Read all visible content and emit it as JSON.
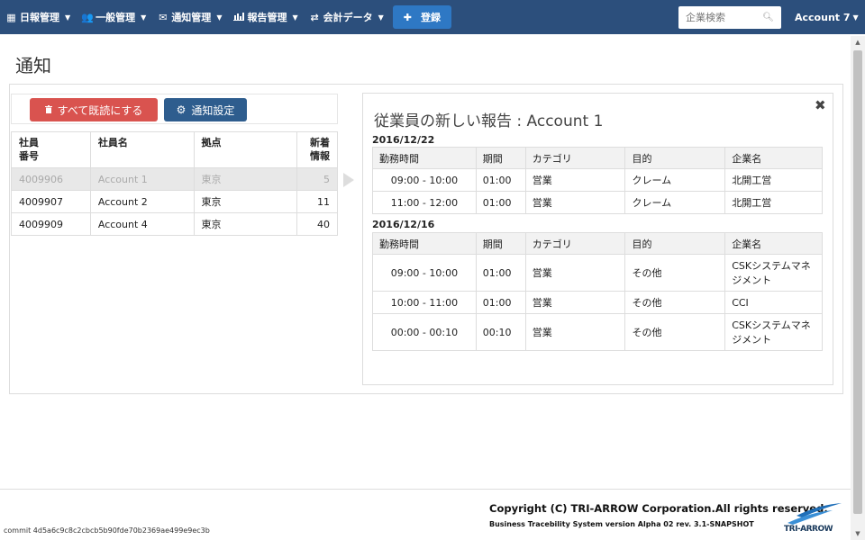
{
  "navbar": {
    "items": [
      {
        "label": "日報管理",
        "icon": "calendar-icon"
      },
      {
        "label": "一般管理",
        "icon": "users-icon"
      },
      {
        "label": "通知管理",
        "icon": "envelope-icon"
      },
      {
        "label": "報告管理",
        "icon": "bar-chart-icon"
      },
      {
        "label": "会計データ",
        "icon": "sync-icon"
      }
    ],
    "register_label": "登録",
    "search_placeholder": "企業検索",
    "account_label": "Account 7"
  },
  "page": {
    "title": "通知"
  },
  "notifications": {
    "mark_all_read_label": "すべて既読にする",
    "settings_label": "通知設定",
    "columns": [
      "社員番号",
      "社員名",
      "拠点",
      "新着情報"
    ],
    "rows": [
      {
        "id": "4009906",
        "name": "Account 1",
        "location": "東京",
        "count": "5"
      },
      {
        "id": "4009907",
        "name": "Account 2",
        "location": "東京",
        "count": "11"
      },
      {
        "id": "4009909",
        "name": "Account 4",
        "location": "東京",
        "count": "40"
      }
    ]
  },
  "detail": {
    "title": "従業員の新しい報告 : Account 1",
    "columns": [
      "勤務時間",
      "期間",
      "カテゴリ",
      "目的",
      "企業名"
    ],
    "groups": [
      {
        "date": "2016/12/22",
        "rows": [
          {
            "time": "09:00 - 10:00",
            "duration": "01:00",
            "category": "営業",
            "purpose": "クレーム",
            "company": "北開工営"
          },
          {
            "time": "11:00 - 12:00",
            "duration": "01:00",
            "category": "営業",
            "purpose": "クレーム",
            "company": "北開工営"
          }
        ]
      },
      {
        "date": "2016/12/16",
        "rows": [
          {
            "time": "09:00 - 10:00",
            "duration": "01:00",
            "category": "営業",
            "purpose": "その他",
            "company": "CSKシステムマネジメント"
          },
          {
            "time": "10:00 - 11:00",
            "duration": "01:00",
            "category": "営業",
            "purpose": "その他",
            "company": "CCI"
          },
          {
            "time": "00:00 - 00:10",
            "duration": "00:10",
            "category": "営業",
            "purpose": "その他",
            "company": "CSKシステムマネジメント"
          }
        ]
      }
    ]
  },
  "footer": {
    "copyright": "Copyright (C) TRI-ARROW Corporation.All rights reserved.",
    "version": "Business Tracebility System version Alpha 02 rev. 3.1-SNAPSHOT",
    "commit": "commit 4d5a6c9c8c2cbcb5b90fde70b2369ae499e9ec3b",
    "logo_text": "TRI-ARROW"
  },
  "colors": {
    "navbar": "#2c4f7c",
    "register_button": "#2e78c4",
    "mark_read_button": "#d9534f",
    "settings_button": "#2e5d8e"
  }
}
